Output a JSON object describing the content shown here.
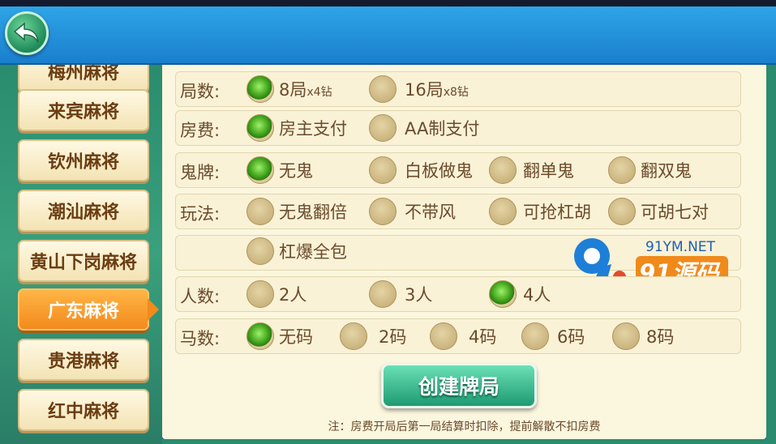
{
  "back_icon": "back-arrow-icon",
  "sidebar": {
    "items": [
      {
        "label": "梅州麻将",
        "active": false
      },
      {
        "label": "来宾麻将",
        "active": false
      },
      {
        "label": "钦州麻将",
        "active": false
      },
      {
        "label": "潮汕麻将",
        "active": false
      },
      {
        "label": "黄山下岗麻将",
        "active": false
      },
      {
        "label": "广东麻将",
        "active": true
      },
      {
        "label": "贵港麻将",
        "active": false
      },
      {
        "label": "红中麻将",
        "active": false
      }
    ]
  },
  "rows": {
    "rounds": {
      "label": "局数:",
      "options": [
        {
          "text": "8局",
          "sub": "x4钻",
          "selected": true
        },
        {
          "text": "16局",
          "sub": "x8钻",
          "selected": false
        }
      ]
    },
    "fee": {
      "label": "房费:",
      "options": [
        {
          "text": "房主支付",
          "selected": true
        },
        {
          "text": "AA制支付",
          "selected": false
        }
      ]
    },
    "ghost": {
      "label": "鬼牌:",
      "options": [
        {
          "text": "无鬼",
          "selected": true
        },
        {
          "text": "白板做鬼",
          "selected": false
        },
        {
          "text": "翻单鬼",
          "selected": false
        },
        {
          "text": "翻双鬼",
          "selected": false
        }
      ]
    },
    "play": {
      "label": "玩法:",
      "options": [
        {
          "text": "无鬼翻倍",
          "selected": false
        },
        {
          "text": "不带风",
          "selected": false
        },
        {
          "text": "可抢杠胡",
          "selected": false
        },
        {
          "text": "可胡七对",
          "selected": false
        },
        {
          "text": "杠爆全包",
          "selected": false
        }
      ]
    },
    "players": {
      "label": "人数:",
      "options": [
        {
          "text": "2人",
          "selected": false
        },
        {
          "text": "3人",
          "selected": false
        },
        {
          "text": "4人",
          "selected": true
        }
      ]
    },
    "horse": {
      "label": "马数:",
      "options": [
        {
          "text": "无码",
          "selected": true
        },
        {
          "text": "2码",
          "selected": false
        },
        {
          "text": "4码",
          "selected": false
        },
        {
          "text": "6码",
          "selected": false
        },
        {
          "text": "8码",
          "selected": false
        }
      ]
    }
  },
  "watermark": {
    "site": "91YM.NET",
    "brand": "91源码"
  },
  "create_button": "创建牌局",
  "note": "注：房费开局后第一局结算时扣除，提前解散不扣房费",
  "colors": {
    "selected_radio": "#3ea219",
    "active_tab": "#f28a1c",
    "button": "#1f9a72"
  }
}
